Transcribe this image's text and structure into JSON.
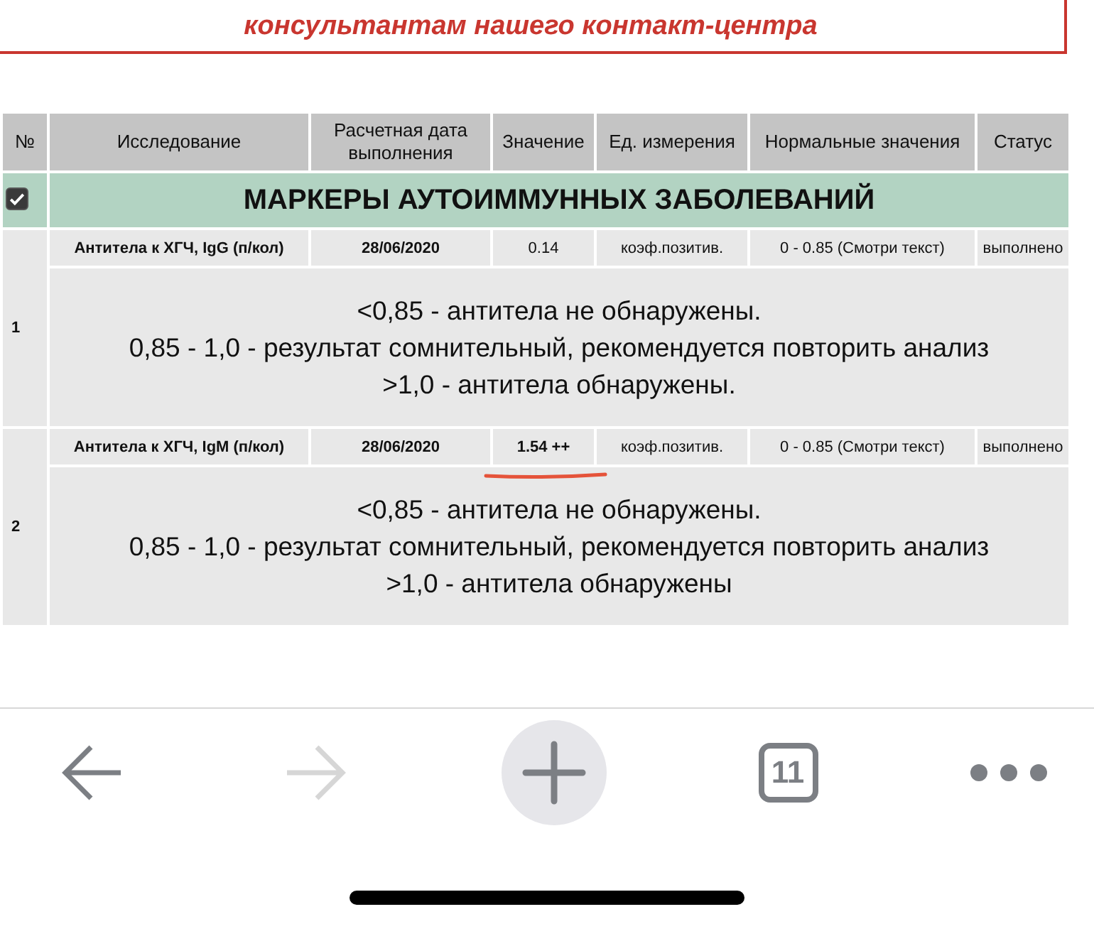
{
  "notice": {
    "text": "консультантам нашего контакт-центра"
  },
  "table": {
    "columns": [
      "№",
      "Исследование",
      "Расчетная дата выполнения",
      "Значение",
      "Ед. измерения",
      "Нормальные значения",
      "Статус"
    ],
    "section": {
      "title": "МАРКЕРЫ АУТОИММУННЫХ ЗАБОЛЕВАНИЙ",
      "checked": true
    },
    "rows": [
      {
        "number": "1",
        "test": "Антитела к ХГЧ, IgG (п/кол)",
        "date": "28/06/2020",
        "value": "0.14",
        "value_bold": false,
        "underlined": false,
        "unit": "коэф.позитив.",
        "norm": "0 - 0.85 (Смотри текст)",
        "status": "выполнено",
        "comment": [
          "<0,85 - антитела не обнаружены.",
          "0,85 - 1,0 - результат сомнительный, рекомендуется повторить анализ",
          ">1,0 - антитела обнаружены."
        ]
      },
      {
        "number": "2",
        "test": "Антитела к ХГЧ, IgM (п/кол)",
        "date": "28/06/2020",
        "value": "1.54 ++",
        "value_bold": true,
        "underlined": true,
        "unit": "коэф.позитив.",
        "norm": "0 - 0.85 (Смотри текст)",
        "status": "выполнено",
        "comment": [
          "<0,85 - антитела не обнаружены.",
          "0,85 - 1,0 - результат сомнительный, рекомендуется повторить анализ",
          ">1,0 - антитела обнаружены"
        ]
      }
    ]
  },
  "toolbar": {
    "back_disabled": false,
    "forward_disabled": true,
    "tab_count": "11"
  }
}
